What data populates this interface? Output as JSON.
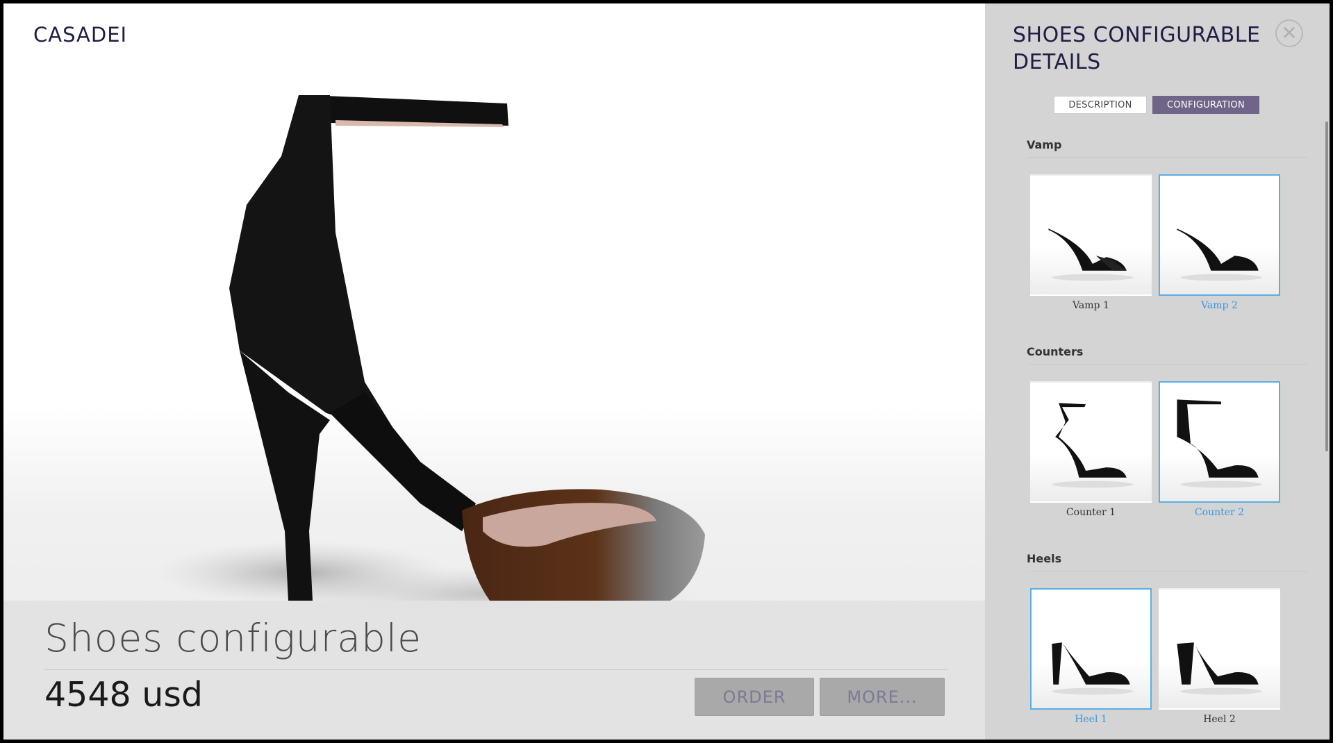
{
  "brand": "CASADEI",
  "product": {
    "name": "Shoes configurable",
    "price": "4548 usd"
  },
  "actions": {
    "order_label": "ORDER",
    "more_label": "MORE..."
  },
  "panel": {
    "title": "SHOES CONFIGURABLE DETAILS",
    "close_icon": "close-icon",
    "tabs": [
      {
        "label": "DESCRIPTION",
        "active": false
      },
      {
        "label": "CONFIGURATION",
        "active": true
      }
    ],
    "sections": [
      {
        "title": "Vamp",
        "options": [
          {
            "label": "Vamp 1",
            "selected": false
          },
          {
            "label": "Vamp 2",
            "selected": true
          }
        ]
      },
      {
        "title": "Counters",
        "options": [
          {
            "label": "Counter 1",
            "selected": false
          },
          {
            "label": "Counter 2",
            "selected": true
          }
        ]
      },
      {
        "title": "Heels",
        "options": [
          {
            "label": "Heel 1",
            "selected": true
          },
          {
            "label": "Heel 2",
            "selected": false
          }
        ]
      }
    ]
  },
  "colors": {
    "brand_navy": "#1e1e46",
    "tab_active": "#6e6589",
    "selected_border": "#5aaee6",
    "selected_label": "#3798e0"
  }
}
